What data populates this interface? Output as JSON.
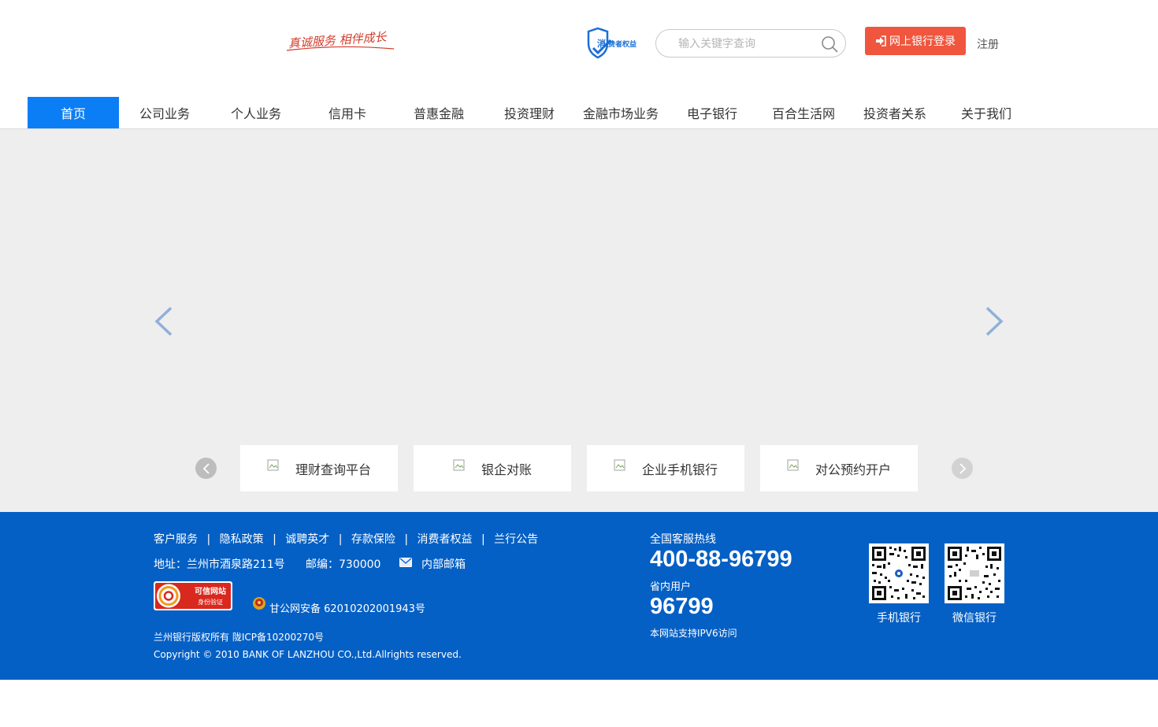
{
  "header": {
    "slogan": "真诚服务 相伴成长",
    "consumer_badge": "消费者权益",
    "search": {
      "placeholder": "输入关键字查询",
      "value": ""
    },
    "login_label": "网上银行登录",
    "register_label": "注册"
  },
  "nav": {
    "items": [
      {
        "label": "首页",
        "active": true
      },
      {
        "label": "公司业务"
      },
      {
        "label": "个人业务"
      },
      {
        "label": "信用卡"
      },
      {
        "label": "普惠金融"
      },
      {
        "label": "投资理财"
      },
      {
        "label": "金融市场业务"
      },
      {
        "label": "电子银行"
      },
      {
        "label": "百合生活网"
      },
      {
        "label": "投资者关系"
      },
      {
        "label": "关于我们"
      }
    ]
  },
  "quick_links": [
    {
      "label": "理财查询平台"
    },
    {
      "label": "银企对账"
    },
    {
      "label": "企业手机银行"
    },
    {
      "label": "对公预约开户"
    }
  ],
  "footer": {
    "links": [
      "客户服务",
      "隐私政策",
      "诚聘英才",
      "存款保险",
      "消费者权益",
      "兰行公告"
    ],
    "separator": "|",
    "address": "地址：兰州市酒泉路211号",
    "postal": "邮编：730000",
    "internal_mail": "内部邮箱",
    "trust_badge_line1": "可信网站",
    "trust_badge_line2": "身份验证",
    "police_record": "甘公网安备 62010202001943号",
    "copyright_line1": "兰州银行版权所有 陇ICP备10200270号",
    "copyright_line2": "Copyright © 2010 BANK OF LANZHOU CO.,Ltd.Allrights reserved.",
    "hotline_label": "全国客服热线",
    "hotline_number": "400-88-96799",
    "province_label": "省内用户",
    "province_number": "96799",
    "ipv6_note": "本网站支持IPV6访问",
    "qr_mobile_label": "手机银行",
    "qr_wechat_label": "微信银行"
  },
  "colors": {
    "accent_blue": "#0b7ef5",
    "footer_blue": "#0560c5",
    "login_red": "#f0563d",
    "banner_gray": "#eeeeee"
  }
}
